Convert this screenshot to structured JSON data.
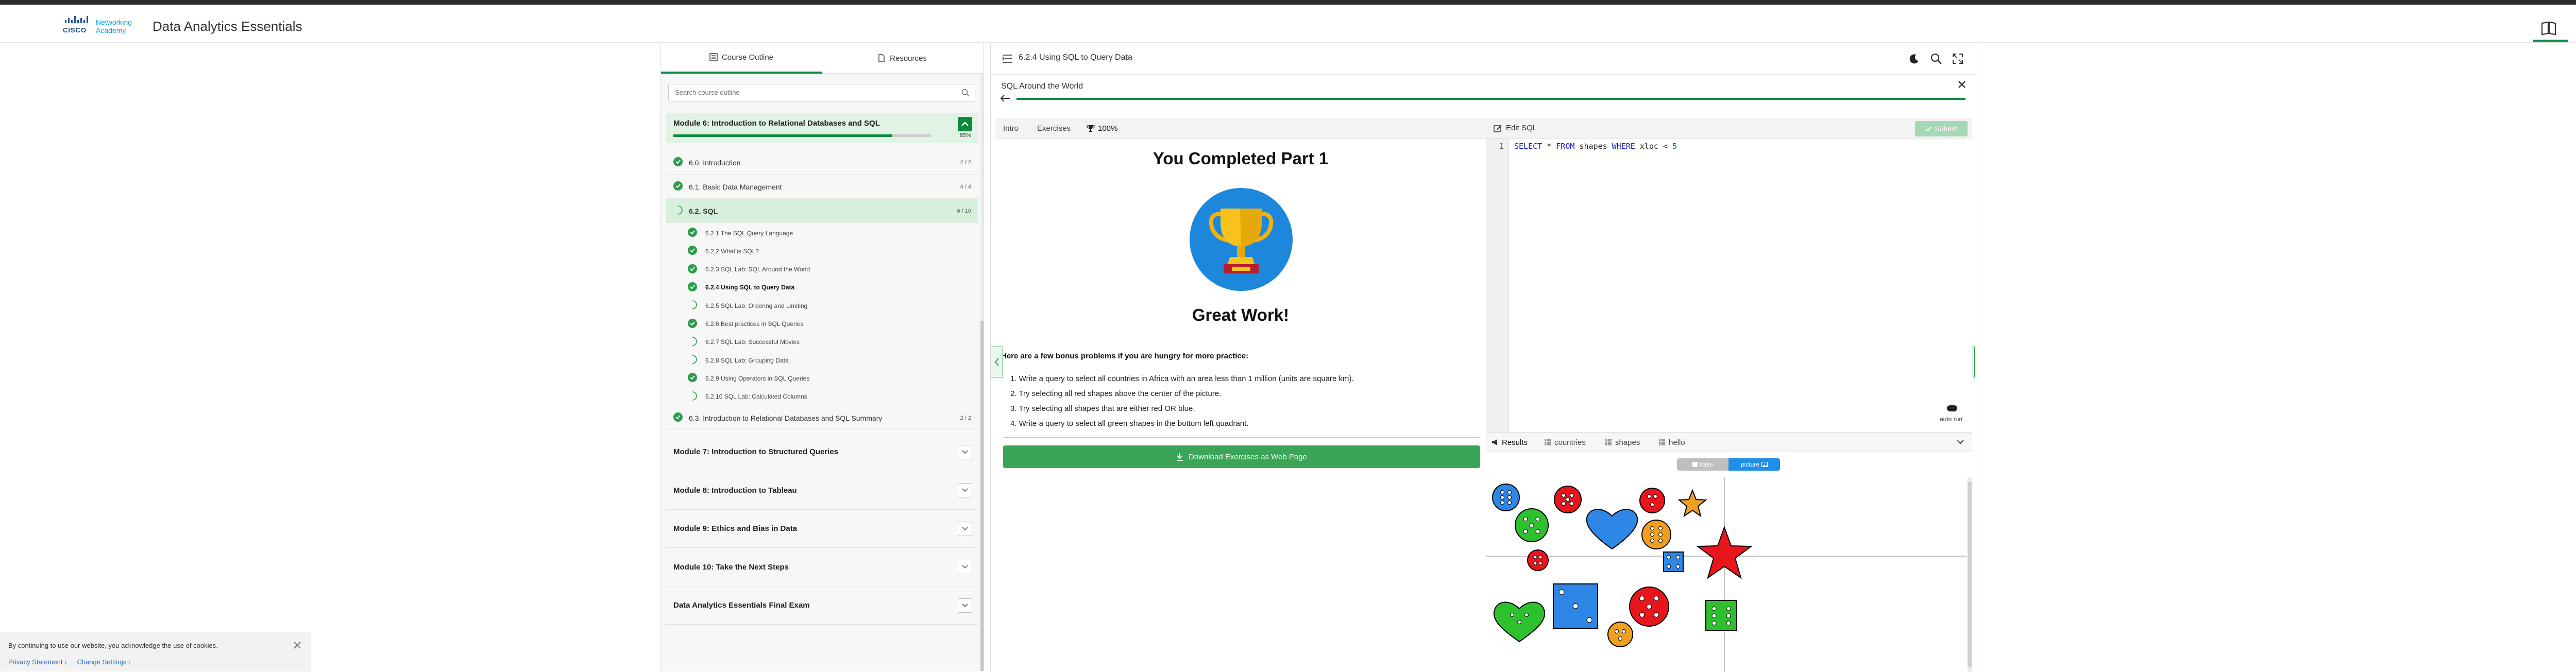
{
  "app": {
    "title": "Data Analytics Essentials",
    "logo_brand": "CISCO",
    "logo_sub_1": "Networking",
    "logo_sub_2": "Academy"
  },
  "toolbar": {
    "icons": [
      "book-icon",
      "chart-icon",
      "close-icon"
    ]
  },
  "left_panel": {
    "tabs": [
      {
        "label": "Course Outline",
        "active": true
      },
      {
        "label": "Resources",
        "active": false
      }
    ],
    "search_placeholder": "Search course outline",
    "current_module": {
      "label": "Module 6: Introduction to Relational Databases and SQL",
      "progress_pct": "85%",
      "progress_fraction": 0.85
    },
    "sections": [
      {
        "label": "6.0. Introduction",
        "count": "2 / 2",
        "done": true
      },
      {
        "label": "6.1. Basic Data Management",
        "count": "4 / 4",
        "done": true
      },
      {
        "label": "6.2. SQL",
        "count": "6 / 10",
        "done": false,
        "active": true
      }
    ],
    "subsections": [
      {
        "label": "6.2.1 The SQL Query Language",
        "done": true
      },
      {
        "label": "6.2.2 What is SQL?",
        "done": true
      },
      {
        "label": "6.2.3 SQL Lab: SQL Around the World",
        "done": true
      },
      {
        "label": "6.2.4 Using SQL to Query Data",
        "done": true,
        "current": true
      },
      {
        "label": "6.2.5 SQL Lab: Ordering and Limiting",
        "done": false
      },
      {
        "label": "6.2.6 Best practices in SQL Queries",
        "done": true
      },
      {
        "label": "6.2.7 SQL Lab: Successful Movies",
        "done": false
      },
      {
        "label": "6.2.8 SQL Lab: Grouping Data",
        "done": false
      },
      {
        "label": "6.2.9 Using Operators in SQL Queries",
        "done": true
      },
      {
        "label": "6.2.10 SQL Lab: Calculated Columns",
        "done": false
      }
    ],
    "section_after": {
      "label": "6.3. Introduction to Relational Databases and SQL Summary",
      "count": "2 / 2",
      "done": true
    },
    "modules": [
      "Module 7: Introduction to Structured Queries",
      "Module 8: Introduction to Tableau",
      "Module 9: Ethics and Bias in Data",
      "Module 10: Take the Next Steps",
      "Data Analytics Essentials Final Exam"
    ]
  },
  "right_panel": {
    "header_title": "6.2.4 Using SQL to Query Data",
    "lab_title": "SQL Around the World",
    "tabs": [
      {
        "label": "Intro"
      },
      {
        "label": "Exercises"
      },
      {
        "label": "100%",
        "icon": "trophy-icon",
        "active": true
      }
    ],
    "completion": {
      "heading": "You Completed Part 1",
      "subheading": "Great Work!",
      "bonus_intro": "Here are a few bonus problems if you are hungry for more practice:",
      "bonus_items": [
        "1. Write a query to select all countries in Africa with an area less than 1 million (units are square km).",
        "2. Try selecting all red shapes above the center of the picture.",
        "3. Try selecting all shapes that are either red OR blue.",
        "4. Write a query to select all green shapes in the bottom left quadrant."
      ],
      "download_label": "Download Exercises as Web Page"
    },
    "editor": {
      "header_label": "Edit SQL",
      "submit_label": "Submit",
      "line_number": "1",
      "code_tokens": [
        "SELECT",
        " * ",
        "FROM",
        " shapes ",
        "WHERE",
        " xloc < ",
        "5"
      ],
      "autorun_label": "auto run"
    },
    "results": {
      "tabs": [
        {
          "label": "Results",
          "active": true
        },
        {
          "label": "countries"
        },
        {
          "label": "shapes"
        },
        {
          "label": "hello"
        }
      ],
      "view_toggle": [
        {
          "label": "table",
          "active": false
        },
        {
          "label": "picture",
          "active": true
        }
      ]
    }
  },
  "cookie_banner": {
    "text": "By continuing to use our website, you acknowledge the use of cookies.",
    "links": [
      "Privacy Statement ›",
      "Change Settings ›"
    ]
  },
  "colors": {
    "accent_green": "#0d8a3e",
    "submit_disabled": "#a5d8b4",
    "button_green": "#3aa556",
    "toggle_blue": "#1e8ee8"
  }
}
